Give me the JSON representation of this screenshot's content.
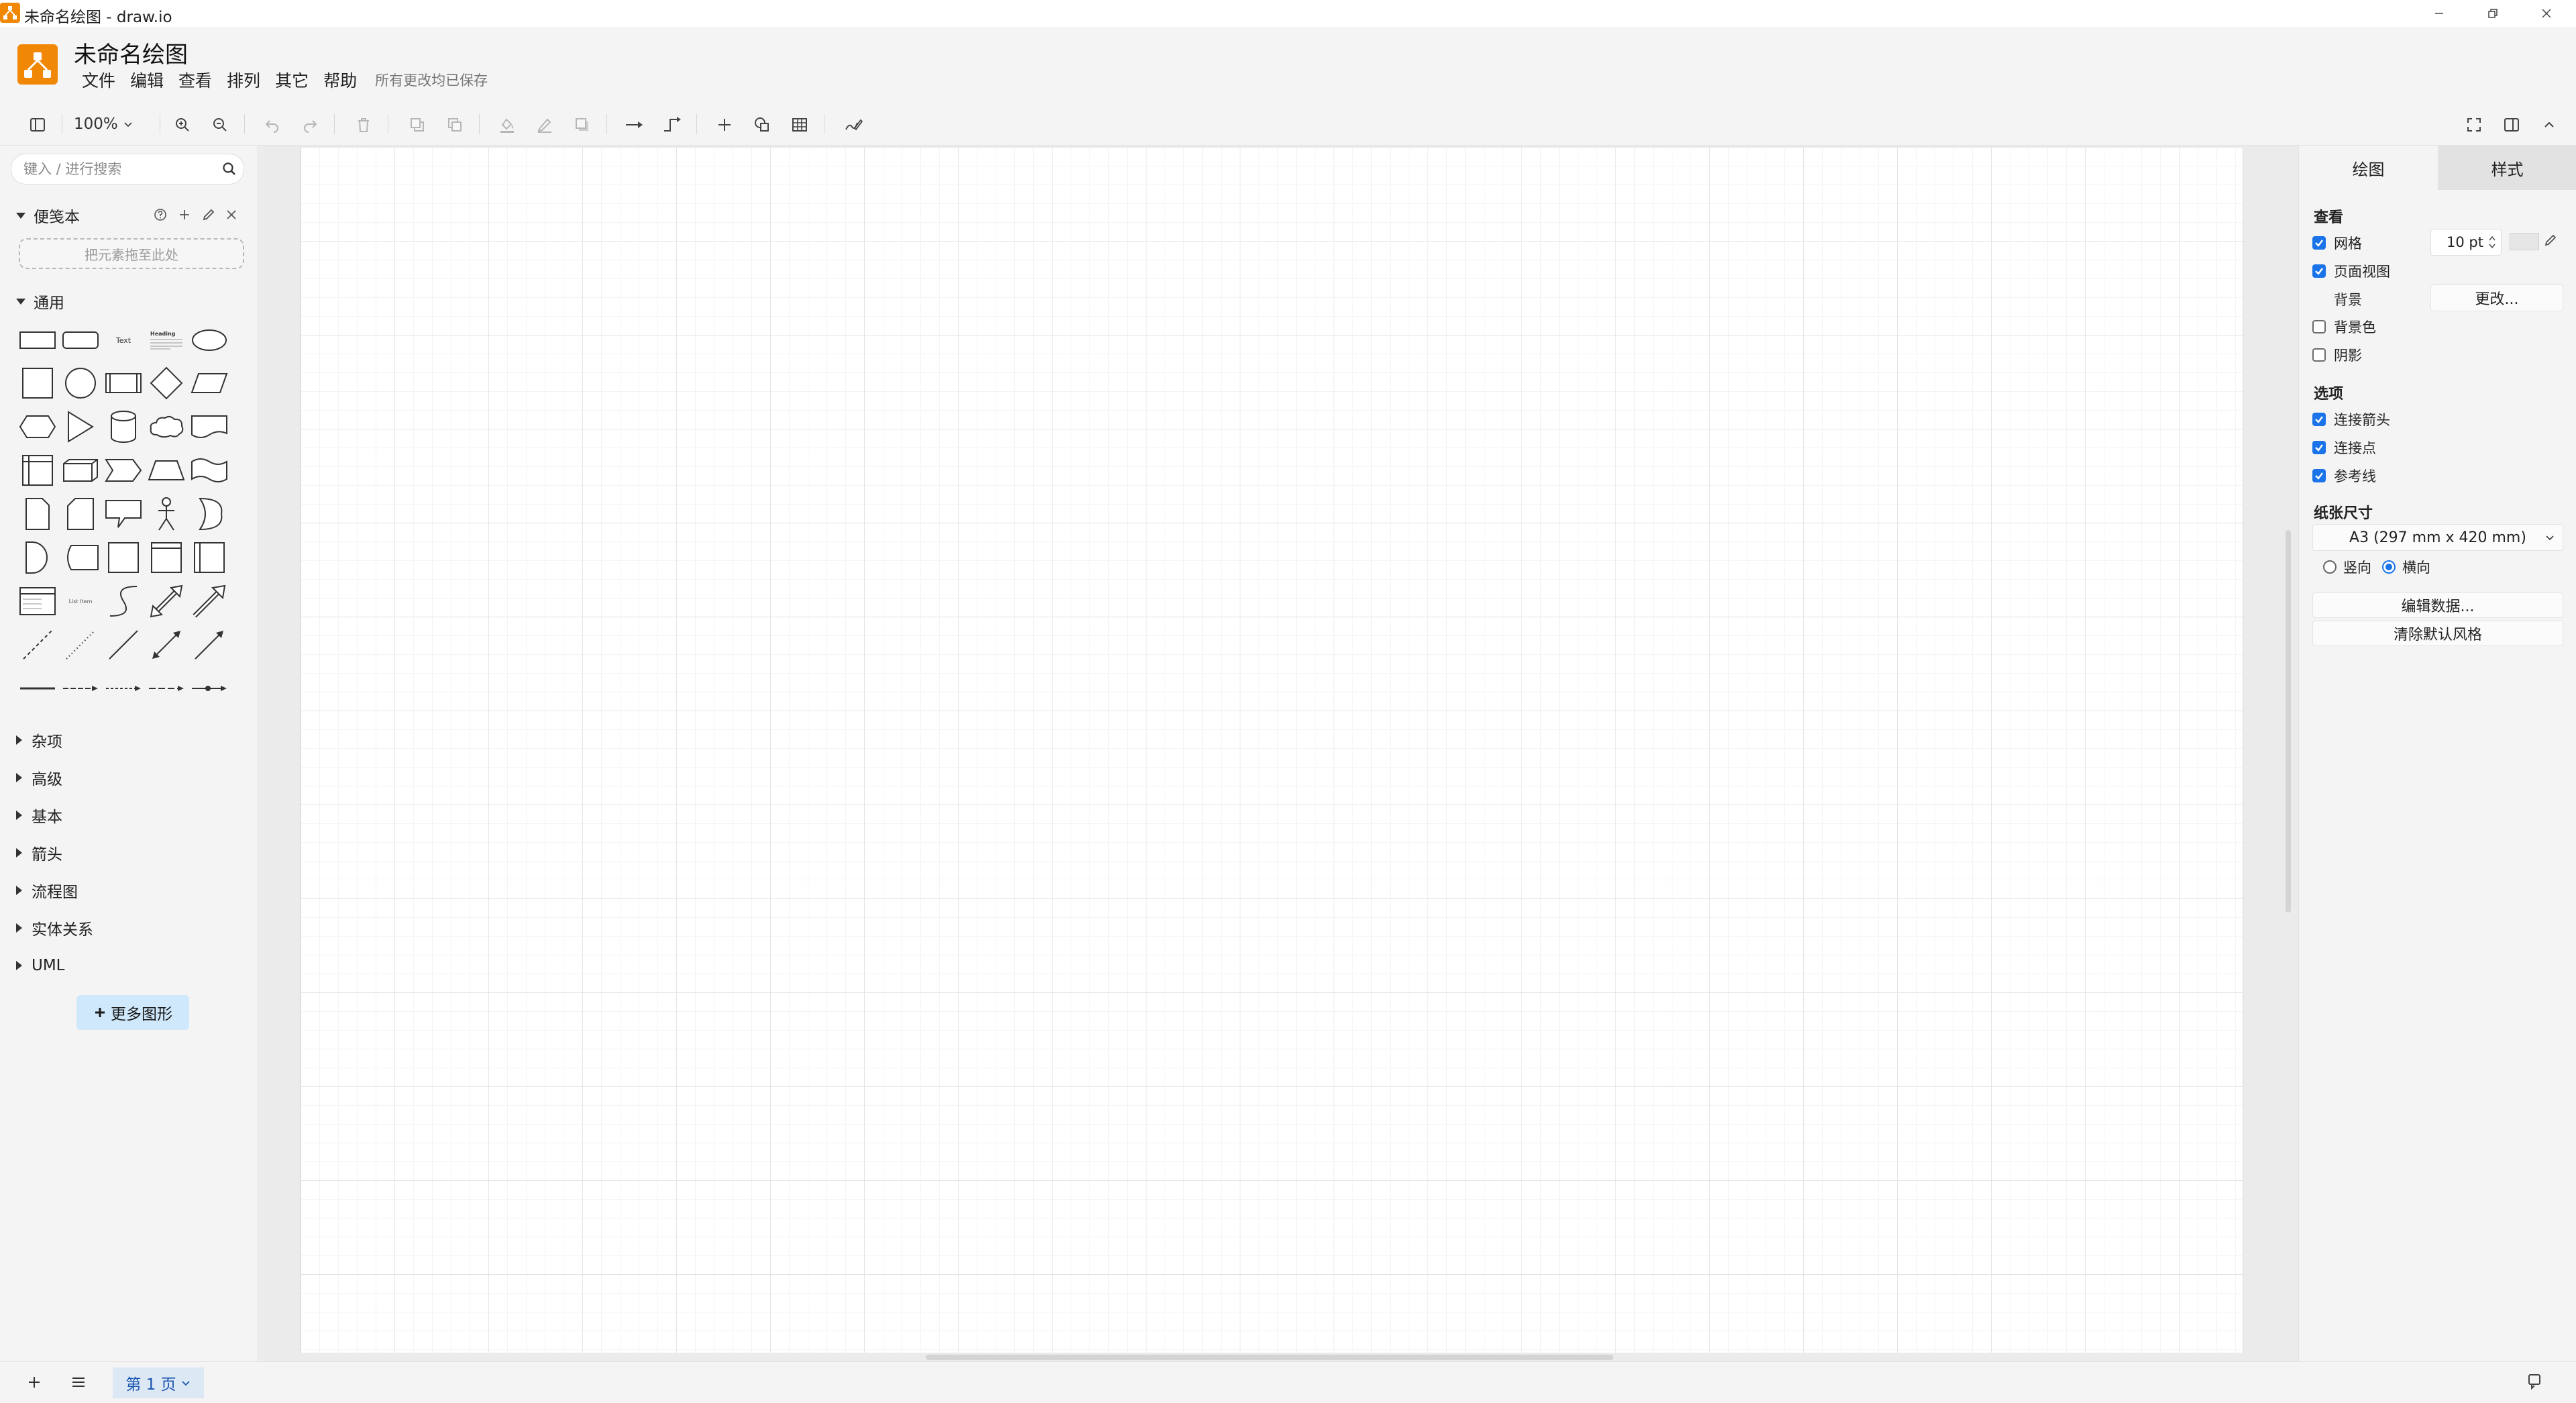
{
  "window": {
    "title": "未命名绘图 - draw.io",
    "controls": [
      "minimize-icon",
      "restore-icon",
      "close-icon"
    ]
  },
  "app": {
    "document_title": "未命名绘图",
    "brand_color": "#f08705",
    "menu": [
      "文件",
      "编辑",
      "查看",
      "排列",
      "其它",
      "帮助"
    ],
    "save_status": "所有更改均已保存"
  },
  "toolbar": {
    "zoom": "100%",
    "icons": [
      "sidebar-toggle-icon",
      "zoom-in-icon",
      "zoom-out-icon",
      "undo-icon",
      "redo-icon",
      "delete-icon",
      "to-front-icon",
      "to-back-icon",
      "fill-color-icon",
      "line-color-icon",
      "shadow-icon",
      "connection-icon",
      "waypoints-icon",
      "insert-icon",
      "shapes-icon",
      "table-icon",
      "freehand-icon",
      "fullscreen-icon",
      "format-panel-icon",
      "collapse-icon"
    ]
  },
  "sidebar": {
    "search_placeholder": "键入 / 进行搜索",
    "scratchpad": {
      "title": "便笺本",
      "drop_hint": "把元素拖至此处"
    },
    "general": {
      "title": "通用",
      "shapes": [
        [
          "rectangle",
          "rounded-rectangle",
          "text",
          "textbox",
          "ellipse"
        ],
        [
          "square",
          "circle",
          "process",
          "diamond",
          "parallelogram"
        ],
        [
          "hexagon",
          "triangle",
          "cylinder",
          "cloud",
          "document"
        ],
        [
          "internal-storage",
          "cube",
          "step",
          "trapezoid",
          "tape"
        ],
        [
          "note",
          "card",
          "callout",
          "actor",
          "or"
        ],
        [
          "data-storage",
          "and",
          "container",
          "vertical-container",
          "horizontal-container"
        ],
        [
          "list",
          "list-item",
          "curve",
          "bidirectional-arrow",
          "arrow"
        ],
        [
          "dashed-line",
          "dotted-line",
          "line",
          "bidirectional-connector",
          "directional-connector"
        ],
        [
          "connector-solid",
          "connector-dashed-arrow",
          "connector-dashed",
          "connector-long-dashed",
          "connector-with-dots"
        ]
      ],
      "text_label": "Text",
      "heading_label": "Heading",
      "list_item_label": "List Item"
    },
    "categories": [
      "杂项",
      "高级",
      "基本",
      "箭头",
      "流程图",
      "实体关系",
      "UML"
    ],
    "more_shapes": "更多图形"
  },
  "format_panel": {
    "tabs": [
      "绘图",
      "样式"
    ],
    "view": {
      "title": "查看",
      "grid_label": "网格",
      "grid_checked": true,
      "grid_size": "10 pt",
      "page_view_label": "页面视图",
      "page_view_checked": true,
      "background_label": "背景",
      "change_button": "更改...",
      "background_color_label": "背景色",
      "background_color_checked": false,
      "shadow_label": "阴影",
      "shadow_checked": false
    },
    "options": {
      "title": "选项",
      "connection_arrows": "连接箭头",
      "connection_points": "连接点",
      "guides": "参考线",
      "all_checked": true
    },
    "paper": {
      "title": "纸张尺寸",
      "size": "A3 (297 mm x 420 mm)",
      "portrait": "竖向",
      "landscape": "横向",
      "selected": "横向"
    },
    "edit_data_button": "编辑数据...",
    "clear_style_button": "清除默认风格"
  },
  "bottom": {
    "page_tab": "第 1 页"
  }
}
